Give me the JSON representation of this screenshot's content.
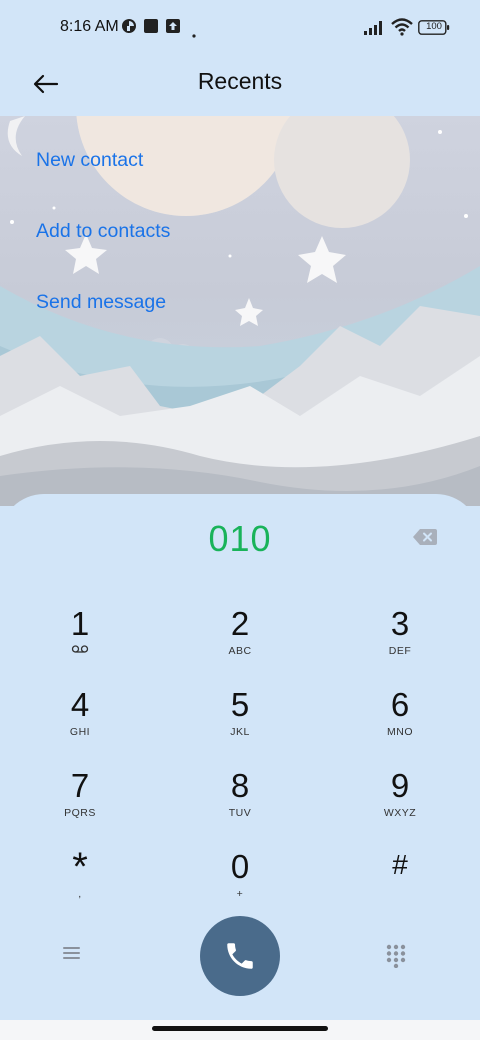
{
  "status_bar": {
    "time": "8:16 AM",
    "left_icons": [
      "vpn-icon",
      "square-notification-icon",
      "upload-icon",
      "dot-icon"
    ],
    "right_icons": [
      "signal-icon",
      "wifi-icon",
      "battery-icon"
    ],
    "battery_level": "100"
  },
  "header": {
    "title": "Recents",
    "back_icon": "back-arrow-icon"
  },
  "actions": [
    {
      "label": "New contact"
    },
    {
      "label": "Add to contacts"
    },
    {
      "label": "Send message"
    }
  ],
  "dialer": {
    "number": "010",
    "backspace_icon": "backspace-icon",
    "keys": [
      {
        "digit": "1",
        "letters": ""
      },
      {
        "digit": "2",
        "letters": "ABC"
      },
      {
        "digit": "3",
        "letters": "DEF"
      },
      {
        "digit": "4",
        "letters": "GHI"
      },
      {
        "digit": "5",
        "letters": "JKL"
      },
      {
        "digit": "6",
        "letters": "MNO"
      },
      {
        "digit": "7",
        "letters": "PQRS"
      },
      {
        "digit": "8",
        "letters": "TUV"
      },
      {
        "digit": "9",
        "letters": "WXYZ"
      },
      {
        "digit": "*",
        "letters": ","
      },
      {
        "digit": "0",
        "letters": "+"
      },
      {
        "digit": "#",
        "letters": ""
      }
    ],
    "key1_sub_icon": "voicemail-icon",
    "menu_icon": "menu-icon",
    "call_icon": "phone-icon",
    "dialpad_icon": "dialpad-icon"
  },
  "colors": {
    "background": "#d2e5f8",
    "link": "#1a73e8",
    "number": "#19b35a",
    "call_button": "#4a6b8b"
  }
}
